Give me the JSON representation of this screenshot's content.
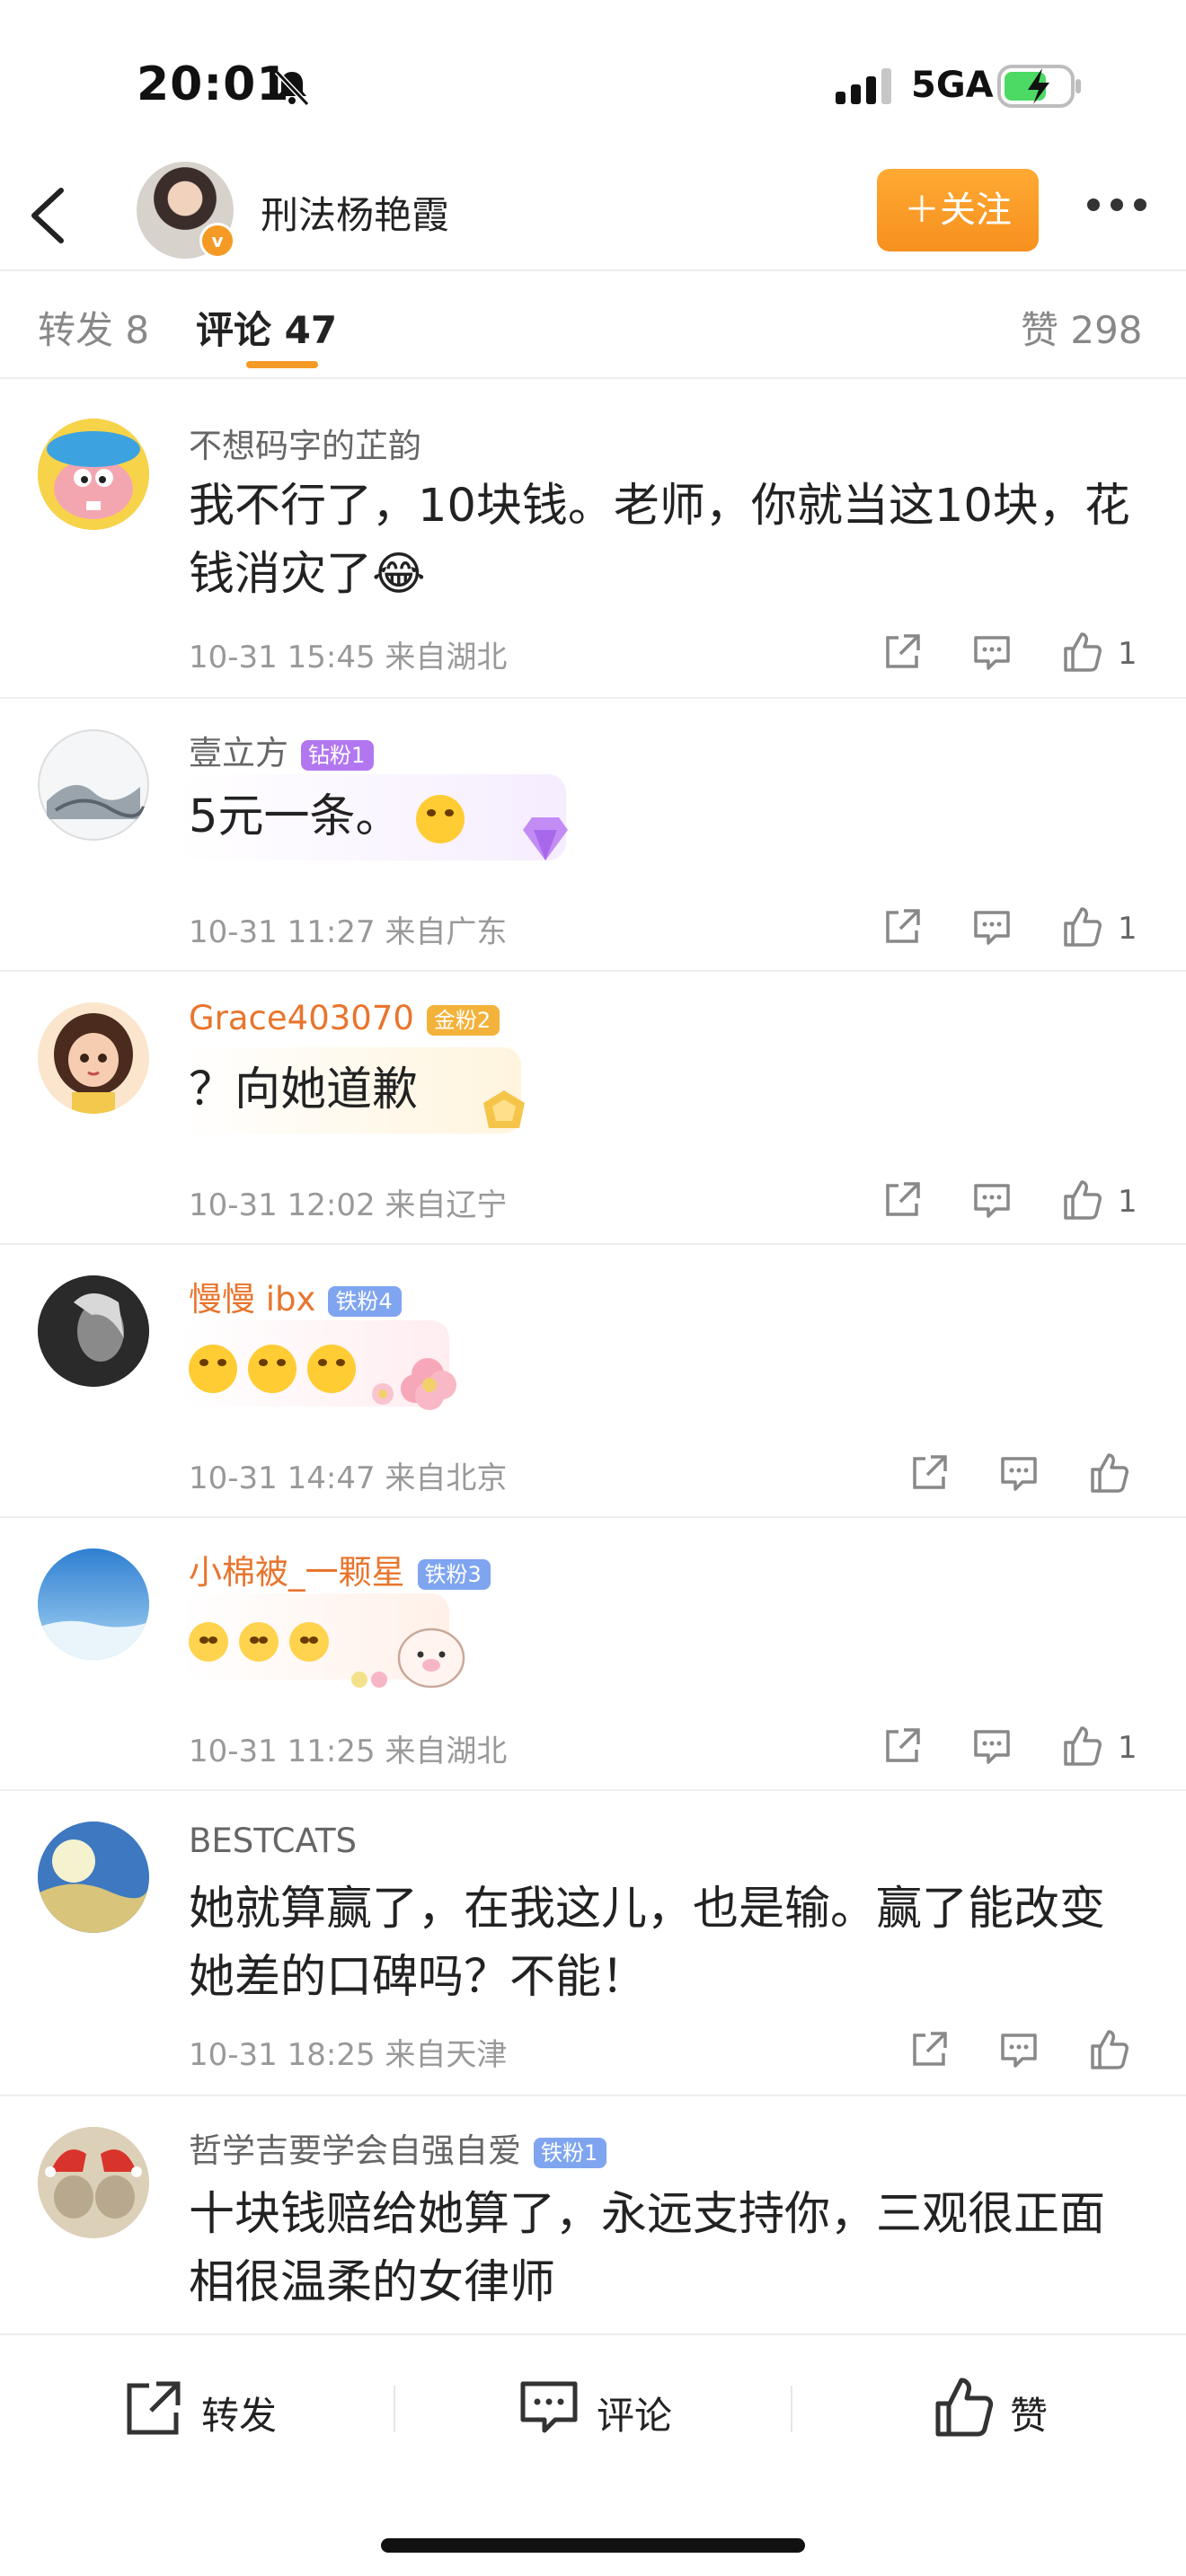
{
  "status": {
    "time": "20:01",
    "network": "5GA"
  },
  "nav": {
    "title": "刑法杨艳霞",
    "verified_mark": "v",
    "follow_label": "＋关注"
  },
  "tabs": {
    "repost": "转发 8",
    "comment": "评论 47",
    "likes": "赞 298"
  },
  "comments": [
    {
      "name": "不想码字的芷韵",
      "badge": "",
      "text": "我不行了，10块钱。老师，你就当这10块，花钱消灾了😂",
      "meta": "10-31 15:45 来自湖北",
      "likes": "1"
    },
    {
      "name": "壹立方",
      "badge": "钻粉1",
      "text": "5元一条。",
      "meta": "10-31 11:27 来自广东",
      "likes": "1"
    },
    {
      "name": "Grace403070",
      "badge": "金粉2",
      "text": "？向她道歉",
      "meta": "10-31 12:02 来自辽宁",
      "likes": "1"
    },
    {
      "name": "慢慢 ibx",
      "badge": "铁粉4",
      "text": "",
      "meta": "10-31 14:47 来自北京",
      "likes": ""
    },
    {
      "name": "小棉被_一颗星",
      "badge": "铁粉3",
      "text": "",
      "meta": "10-31 11:25 来自湖北",
      "likes": "1"
    },
    {
      "name": "BESTCATS",
      "badge": "",
      "text": "她就算赢了，在我这儿，也是输。赢了能改变她差的口碑吗？不能！",
      "meta": "10-31 18:25 来自天津",
      "likes": ""
    },
    {
      "name": "哲学吉要学会自强自爱",
      "badge": "铁粉1",
      "text": "十块钱赔给她算了，永远支持你，三观很正面相很温柔的女律师",
      "meta": "",
      "likes": ""
    }
  ],
  "bottom_bar": {
    "repost": "转发",
    "comment": "评论",
    "like": "赞"
  },
  "colors": {
    "accent": "#f49a25",
    "orange_name": "#e8752d",
    "diamond_badge": "#b277f0",
    "gold_badge": "#f3b23a",
    "iron_badge": "#7fa5f0"
  }
}
